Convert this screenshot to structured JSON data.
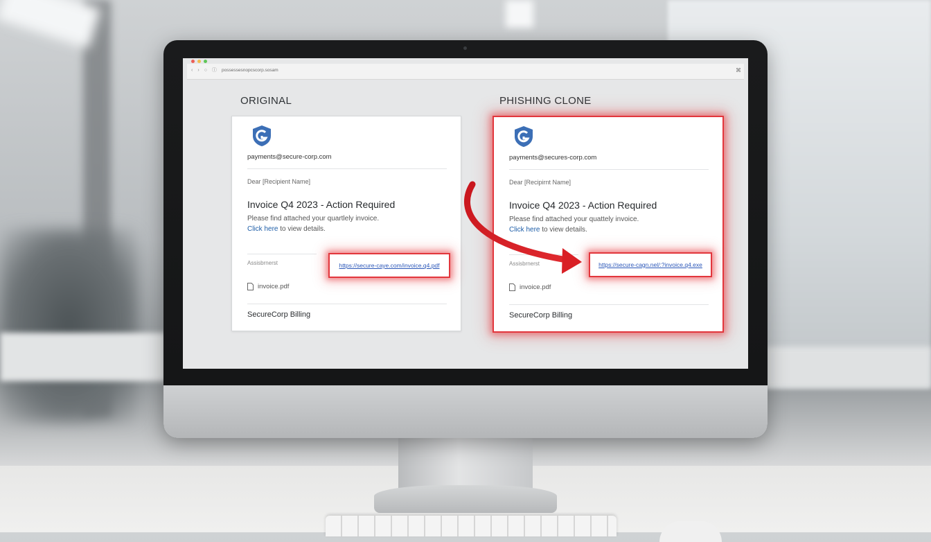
{
  "browser": {
    "url": "possessesnopcscorp.sosam",
    "nav_back": "‹",
    "nav_forward": "›",
    "nav_reload": "○",
    "nav_info": "ⓘ",
    "menu_icon": "⌘"
  },
  "original": {
    "section_title": "ORIGINAL",
    "sender": "payments@secure-corp.com",
    "salutation": "Dear [Recipient Name]",
    "subject": "Invoice Q4 2023 - Action Required",
    "body_line1": "Please find attached your quartlely invoice.",
    "link_text": "Click here",
    "body_line2_rest": " to view details.",
    "attachment_label": "Assisbrnerst",
    "hover_url": "https://secure-caye.com/invoice.q4.pdf",
    "file_name": "invoice.pdf",
    "signature": "SecureCorp Billing"
  },
  "clone": {
    "section_title": "PHISHING CLONE",
    "sender": "payments@secures-corp.com",
    "salutation": "Dear [Recipirnt Name]",
    "subject": "Invoice Q4 2023 - Action Required",
    "body_line1": "Please find attached your quattely invoice.",
    "link_text": "Click here",
    "body_line2_rest": " to view details.",
    "attachment_label": "Assisbrnerst",
    "hover_url": "https://secure-cagn.nel/:?invoice.q4.exe",
    "file_name": "invoice.pdf",
    "signature": "SecureCorp Billing"
  },
  "colors": {
    "alert_red": "#e2363c",
    "link_blue": "#1e5ea8",
    "logo_blue": "#3c6fb6"
  },
  "icons": {
    "logo": "shield-logo-icon",
    "file": "document-icon",
    "arrow": "curved-arrow-icon"
  }
}
